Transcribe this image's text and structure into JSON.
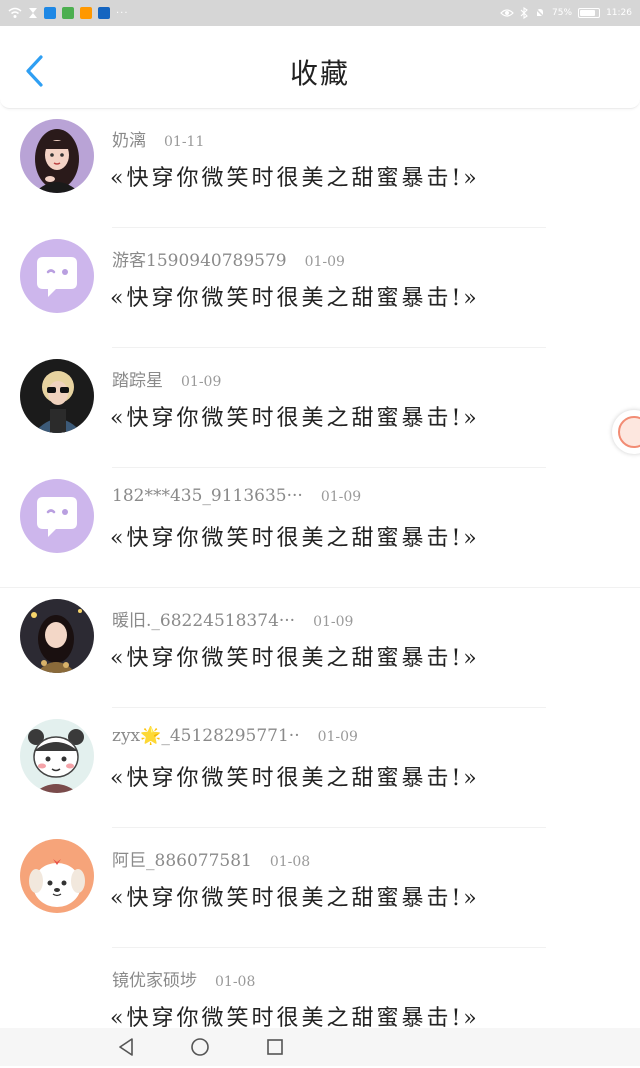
{
  "status_bar": {
    "battery": "75%",
    "time": "11:26",
    "more": "···",
    "app_icon_colors": [
      "#1e88e5",
      "#4caf50",
      "#ff9800",
      "#1565c0"
    ]
  },
  "header": {
    "title": "收藏",
    "back_icon": "chevron-left-icon",
    "accent": "#2f9ff3"
  },
  "items": [
    {
      "user": "奶漓",
      "date": "01-11",
      "book": "«快穿你微笑时很美之甜蜜暴击!»",
      "avatar": "girl-portrait"
    },
    {
      "user": "游客1590940789579",
      "date": "01-09",
      "book": "«快穿你微笑时很美之甜蜜暴击!»",
      "avatar": "default-chat-bubble"
    },
    {
      "user": "踏踪星",
      "date": "01-09",
      "book": "«快穿你微笑时很美之甜蜜暴击!»",
      "avatar": "sunglasses-portrait"
    },
    {
      "user": "182***435_9113635···",
      "date": "01-09",
      "book": "«快穿你微笑时很美之甜蜜暴击!»",
      "avatar": "default-chat-bubble"
    },
    {
      "user": "暖旧._68224518374···",
      "date": "01-09",
      "book": "«快穿你微笑时很美之甜蜜暴击!»",
      "avatar": "night-photo-portrait"
    },
    {
      "user": "zyx🌟_45128295771··",
      "date": "01-09",
      "book": "«快穿你微笑时很美之甜蜜暴击!»",
      "avatar": "cartoon-character"
    },
    {
      "user": "阿巨_886077581",
      "date": "01-08",
      "book": "«快穿你微笑时很美之甜蜜暴击!»",
      "avatar": "cartoon-puppy"
    },
    {
      "user": "镜优家硕埗",
      "date": "01-08",
      "book": "«快穿你微笑时很美之甜蜜暴击!»",
      "avatar": "none"
    }
  ],
  "nav_bar": {
    "back_icon": "triangle-back-icon",
    "home_icon": "circle-home-icon",
    "recents_icon": "square-recents-icon"
  }
}
